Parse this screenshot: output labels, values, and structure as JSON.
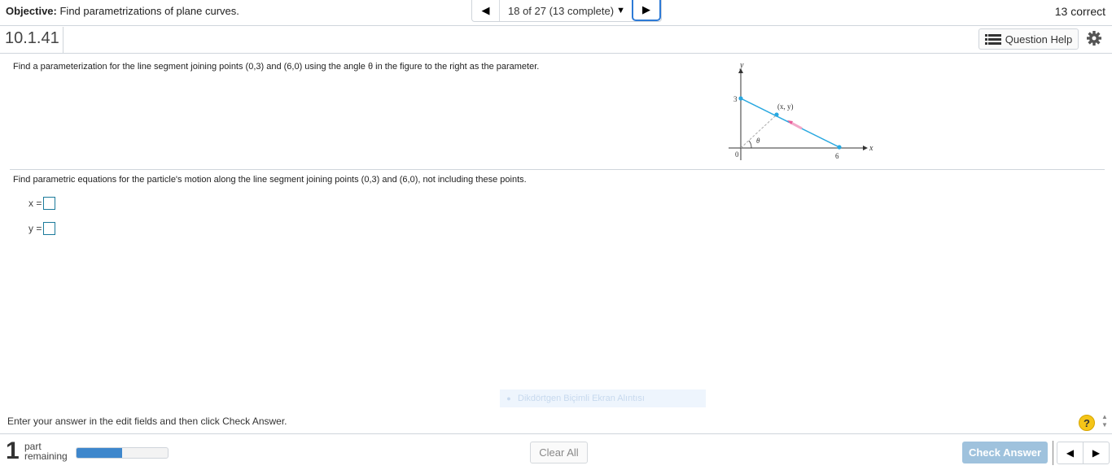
{
  "header": {
    "objective_label": "Objective:",
    "objective_text": "Find parametrizations of plane curves.",
    "nav_position": "18 of 27 (13 complete)",
    "correct_count": "13 correct"
  },
  "question": {
    "number": "10.1.41",
    "help_label": "Question Help",
    "prompt": "Find a parameterization for the line segment joining points (0,3) and (6,0) using the angle θ in the figure to the right as the parameter.",
    "sub_prompt": "Find parametric equations for the particle's motion along the line segment joining points (0,3) and (6,0), not including these points.",
    "equations": [
      {
        "label": "x =",
        "value": ""
      },
      {
        "label": "y =",
        "value": ""
      }
    ],
    "figure": {
      "x_axis_label": "x",
      "y_axis_label": "y",
      "origin_label": "0",
      "y_tick_label": "3",
      "x_tick_label": "6",
      "point_label": "(x, y)",
      "angle_label": "θ"
    }
  },
  "watermark": "Dikdörtgen Biçimli Ekran Alıntısı",
  "footer": {
    "instructions": "Enter your answer in the edit fields and then click Check Answer.",
    "parts_remaining_count": "1",
    "parts_remaining_label_1": "part",
    "parts_remaining_label_2": "remaining",
    "progress_fraction": 0.5,
    "clear_all_label": "Clear All",
    "check_answer_label": "Check Answer",
    "help_symbol": "?"
  },
  "colors": {
    "accent": "#2d7ad6",
    "progress": "#3e87cc",
    "check_answer_bg": "#9fc2dd",
    "segment": "#29a8e0",
    "arrow": "#e85d9a"
  }
}
